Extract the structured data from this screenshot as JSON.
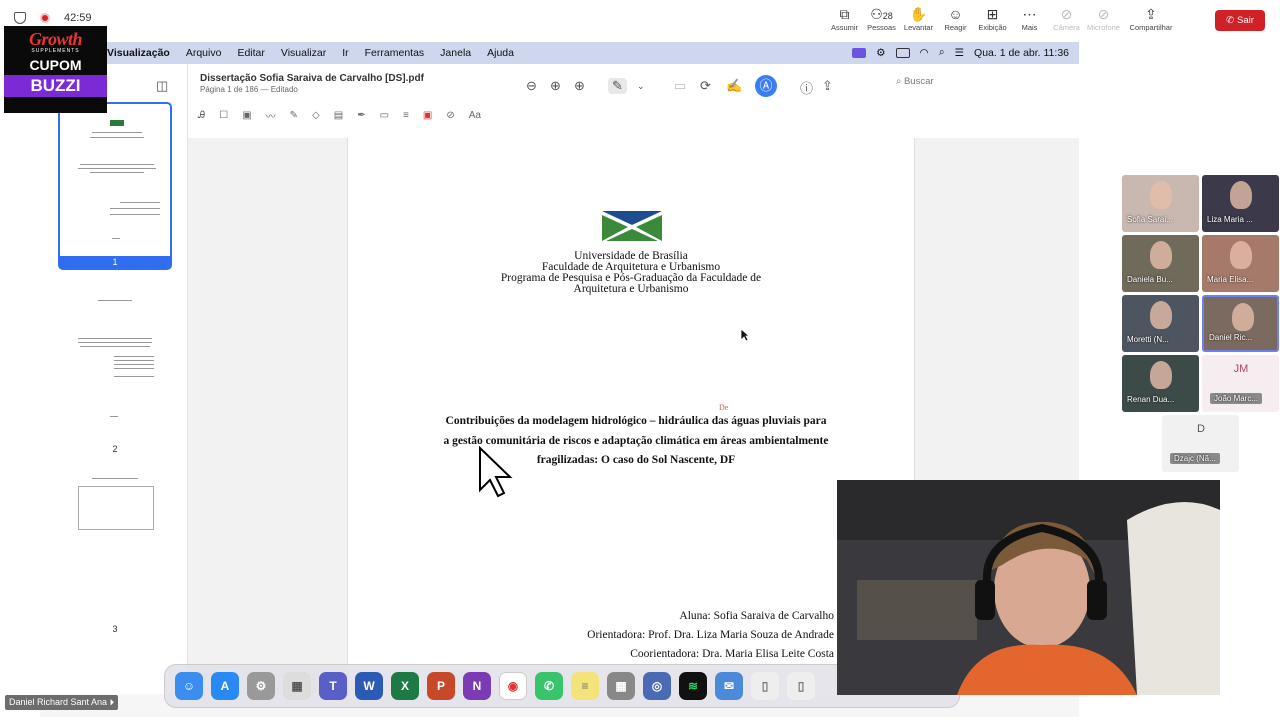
{
  "meeting": {
    "timer": "42:59",
    "tools": [
      {
        "label": "Assumir",
        "icon": "takeover-icon",
        "dim": false
      },
      {
        "label": "Pessoas",
        "icon": "people-icon",
        "dim": false,
        "count": "28"
      },
      {
        "label": "Levantar",
        "icon": "hand-icon",
        "dim": false
      },
      {
        "label": "Reagir",
        "icon": "smile-icon",
        "dim": false
      },
      {
        "label": "Exibição",
        "icon": "grid-icon",
        "dim": false
      },
      {
        "label": "Mais",
        "icon": "more-icon",
        "dim": false
      },
      {
        "label": "Câmera",
        "icon": "camera-off-icon",
        "dim": true
      },
      {
        "label": "Microfone",
        "icon": "mic-off-icon",
        "dim": true
      },
      {
        "label": "Compartilhar",
        "icon": "share-icon",
        "dim": false
      }
    ],
    "exit_label": "Sair",
    "self_name": "Daniel Richard Sant Ana"
  },
  "promo": {
    "brand": "Growth",
    "sub": "SUPPLEMENTS",
    "coupon": "CUPOM",
    "code": "BUZZI"
  },
  "mac": {
    "menu": {
      "app": "Visualização",
      "items": [
        "Arquivo",
        "Editar",
        "Visualizar",
        "Ir",
        "Ferramentas",
        "Janela",
        "Ajuda"
      ],
      "datetime": "Qua. 1 de abr.  11:36"
    },
    "preview": {
      "doc_title": "Dissertação Sofia Saraiva de Carvalho [DS].pdf",
      "doc_status": "Página 1 de 186 — Editado",
      "search_placeholder": "Buscar",
      "thumb_pages": [
        "1",
        "2",
        "3"
      ]
    },
    "page": {
      "header_lines": [
        "Universidade de Brasília",
        "Faculdade de Arquitetura e Urbanismo",
        "Programa de Pesquisa e Pós-Graduação da Faculdade de",
        "Arquitetura e Urbanismo"
      ],
      "title_lines": [
        "Contribuições da modelagem hidrológico – hidráulica das águas pluviais para",
        "a gestão comunitária de riscos e adaptação climática em áreas ambientalmente",
        "fragilizadas: O caso do Sol Nascente, DF"
      ],
      "annotation_mark": "De",
      "author": "Aluna: Sofia Saraiva de Carvalho",
      "advisor": "Orientadora: Prof. Dra. Liza Maria Souza de Andrade",
      "coadvisor": "Coorientadora: Dra. Maria Elisa Leite Costa"
    }
  },
  "participants": [
    {
      "name": "Sofia Sarai...",
      "bg": "#c9b8b0",
      "initials": ""
    },
    {
      "name": "Liza Maria ...",
      "bg": "#3c3a4a",
      "initials": ""
    },
    {
      "name": "Daniela Bu...",
      "bg": "#6f6a5a",
      "initials": ""
    },
    {
      "name": "Maria Elisa...",
      "bg": "#a67a6a",
      "initials": ""
    },
    {
      "name": "Moretti (N...",
      "bg": "#4d5560",
      "initials": ""
    },
    {
      "name": "Daniel Ric...",
      "bg": "#7a6a60",
      "initials": ""
    },
    {
      "name": "Renan Dua...",
      "bg": "#3c4a48",
      "initials": ""
    },
    {
      "name": "João Marc...",
      "bg": "#f6edf0",
      "initials": "JM"
    },
    {
      "name": "Dzajc (Nã...",
      "bg": "#f1f1f1",
      "initials": "D"
    }
  ],
  "colors": {
    "accent": "#2f6ef1",
    "exit": "#d02127",
    "menubar": "#cfd7ef"
  }
}
